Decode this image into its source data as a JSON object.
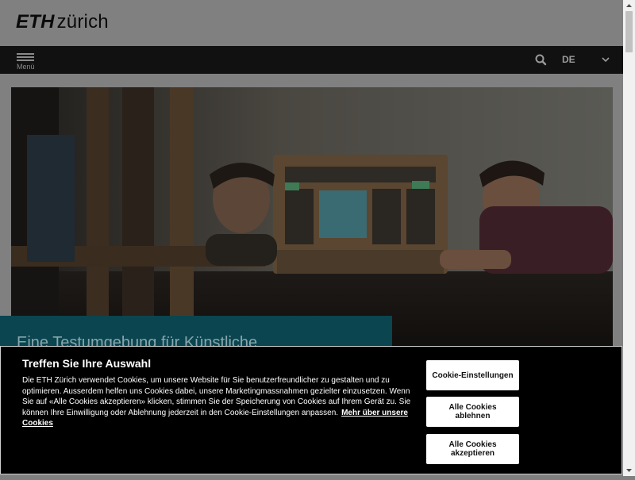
{
  "header": {
    "logo_eth": "ETH",
    "logo_zurich": "zürich",
    "menu_label": "Menü",
    "language": "DE",
    "icons": [
      "menu-icon",
      "search-icon",
      "chevron-down-icon"
    ]
  },
  "hero": {
    "title": "Eine Testumgebung für Künstliche",
    "overlay_color": "#0a4550"
  },
  "cookie_banner": {
    "title": "Treffen Sie Ihre Auswahl",
    "text": "Die ETH Zürich verwendet Cookies, um unsere Website für Sie benutzerfreundlicher zu gestalten und zu optimieren. Ausserdem helfen uns Cookies dabei, unsere Marketingmassnahmen gezielter einzusetzen. Wenn Sie auf «Alle Cookies akzeptieren» klicken, stimmen Sie der Speicherung von Cookies auf Ihrem Gerät zu. Sie können Ihre Einwilligung oder Ablehnung jederzeit in den Cookie-Einstellungen anpassen.",
    "link_label": "Mehr über unsere Cookies",
    "buttons": {
      "settings": "Cookie-Einstellungen",
      "reject": "Alle Cookies ablehnen",
      "accept": "Alle Cookies akzeptieren"
    }
  },
  "colors": {
    "navbar": "#111111",
    "banner_bg": "#000000",
    "button_bg": "#ffffff"
  }
}
